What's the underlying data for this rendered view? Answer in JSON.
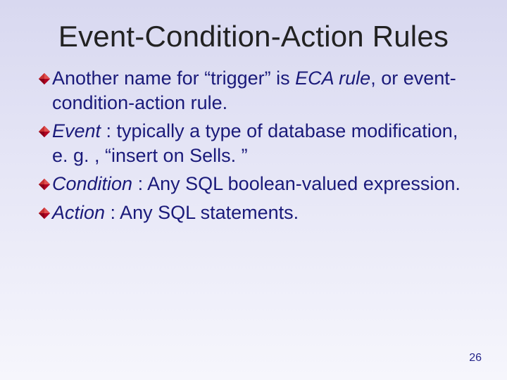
{
  "title": "Event-Condition-Action Rules",
  "bullets": [
    {
      "pre": "Another name for “trigger” is ",
      "em": "ECA rule",
      "post": ", or event-condition-action rule."
    },
    {
      "pre": "",
      "em": "Event ",
      "post": ":  typically a type of database modification, e. g. , “insert on Sells. ”"
    },
    {
      "pre": "",
      "em": "Condition ",
      "post": ": Any SQL boolean-valued expression."
    },
    {
      "pre": "",
      "em": "Action ",
      "post": ": Any SQL statements."
    }
  ],
  "page_number": "26"
}
